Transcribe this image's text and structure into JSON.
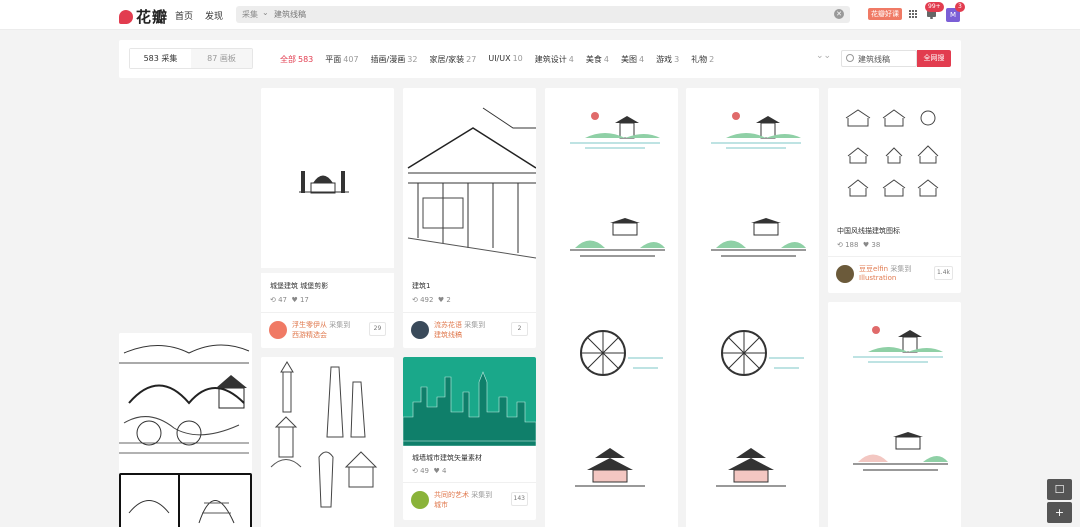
{
  "header": {
    "logo_text": "花瓣",
    "nav": [
      "首页",
      "发现"
    ],
    "search_scope": "采集",
    "search_query": "建筑线稿",
    "promo": "花瓣好课",
    "notif_badge": "99+",
    "avatar_letter": "M",
    "avatar_badge": "3"
  },
  "filters": {
    "seg_pins": "583 采集",
    "seg_boards": "87 画板",
    "categories": [
      {
        "label": "全部",
        "count": "583"
      },
      {
        "label": "平面",
        "count": "407"
      },
      {
        "label": "插画/漫画",
        "count": "32"
      },
      {
        "label": "家居/家装",
        "count": "27"
      },
      {
        "label": "UI/UX",
        "count": "10"
      },
      {
        "label": "建筑设计",
        "count": "4"
      },
      {
        "label": "美食",
        "count": "4"
      },
      {
        "label": "美图",
        "count": "4"
      },
      {
        "label": "游戏",
        "count": "3"
      },
      {
        "label": "礼物",
        "count": "2"
      }
    ],
    "search_value": "建筑线稿",
    "search_button": "全网搜"
  },
  "cards": {
    "c1": {
      "title": "城堡建筑 城堡剪影",
      "repins": "47",
      "likes": "17",
      "user": "浮生零伊从",
      "action": "采集到",
      "board": "西游精选会",
      "count": "29"
    },
    "c2": {
      "title": "建筑1",
      "repins": "492",
      "likes": "2",
      "user": "流苏花语",
      "action": "采集到",
      "board": "建筑线稿",
      "count": "2"
    },
    "c3": {
      "title": "城墙城市建筑矢量素材",
      "repins": "49",
      "likes": "4",
      "user": "共同的艺术",
      "action": "采集到",
      "board": "城市",
      "count": "143"
    },
    "c4": {
      "title": "中国风线描建筑图标",
      "repins": "188",
      "likes": "38",
      "user": "豆豆elfin",
      "action": "采集到",
      "board": "Illustration",
      "count": "1.4k"
    }
  },
  "colors": {
    "accent": "#e23c4f",
    "promo": "#f07a65",
    "avatar": "#7b5fd6"
  }
}
